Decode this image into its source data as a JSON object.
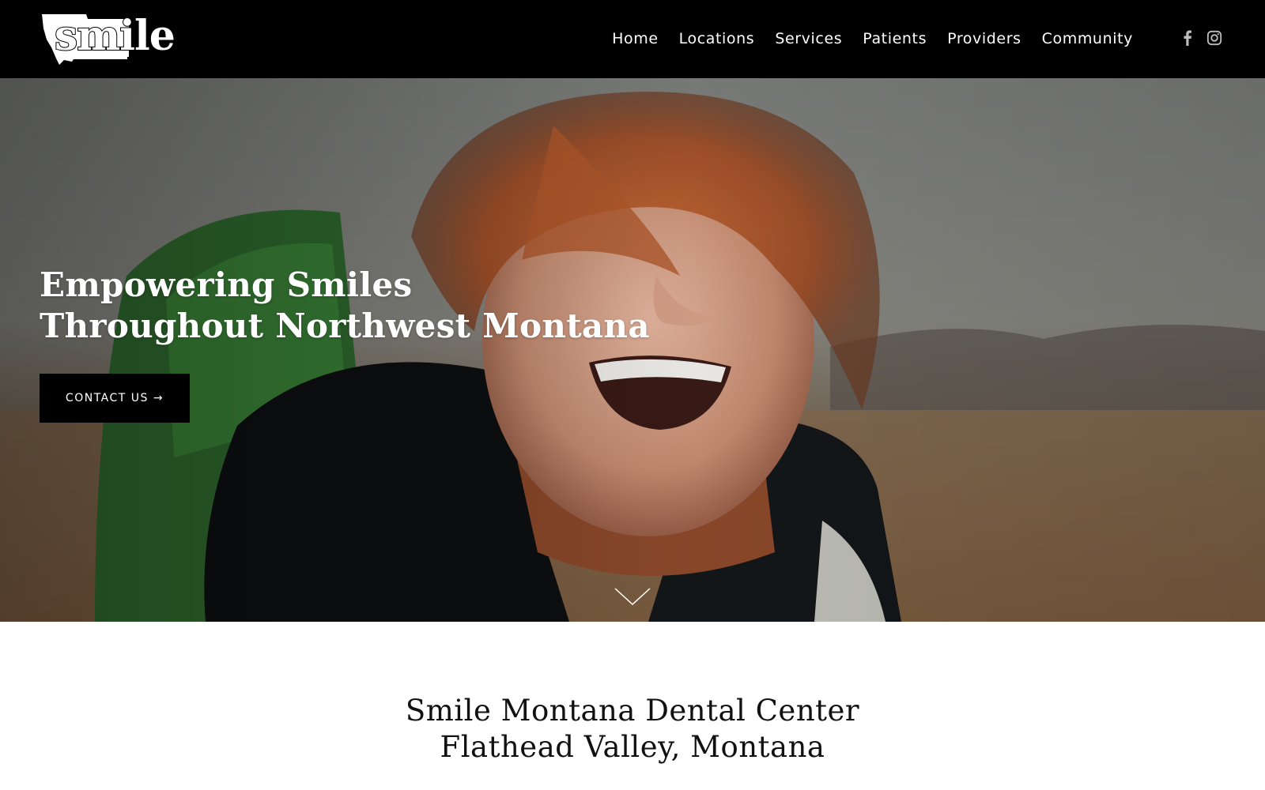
{
  "header": {
    "logo_text": "smile",
    "nav": [
      {
        "label": "Home"
      },
      {
        "label": "Locations"
      },
      {
        "label": "Services"
      },
      {
        "label": "Patients"
      },
      {
        "label": "Providers"
      },
      {
        "label": "Community"
      }
    ],
    "social": [
      {
        "icon": "facebook-icon"
      },
      {
        "icon": "instagram-icon"
      }
    ]
  },
  "hero": {
    "title_line1": "Empowering Smiles",
    "title_line2": "Throughout Northwest Montana",
    "cta_label": "CONTACT US →",
    "scroll_icon": "chevron-down-icon"
  },
  "intro": {
    "title_line1": "Smile Montana Dental Center",
    "title_line2": "Flathead Valley, Montana"
  },
  "colors": {
    "header_bg": "#000000",
    "nav_text": "#ffffff",
    "button_bg": "#000000",
    "body_text": "#111111"
  }
}
